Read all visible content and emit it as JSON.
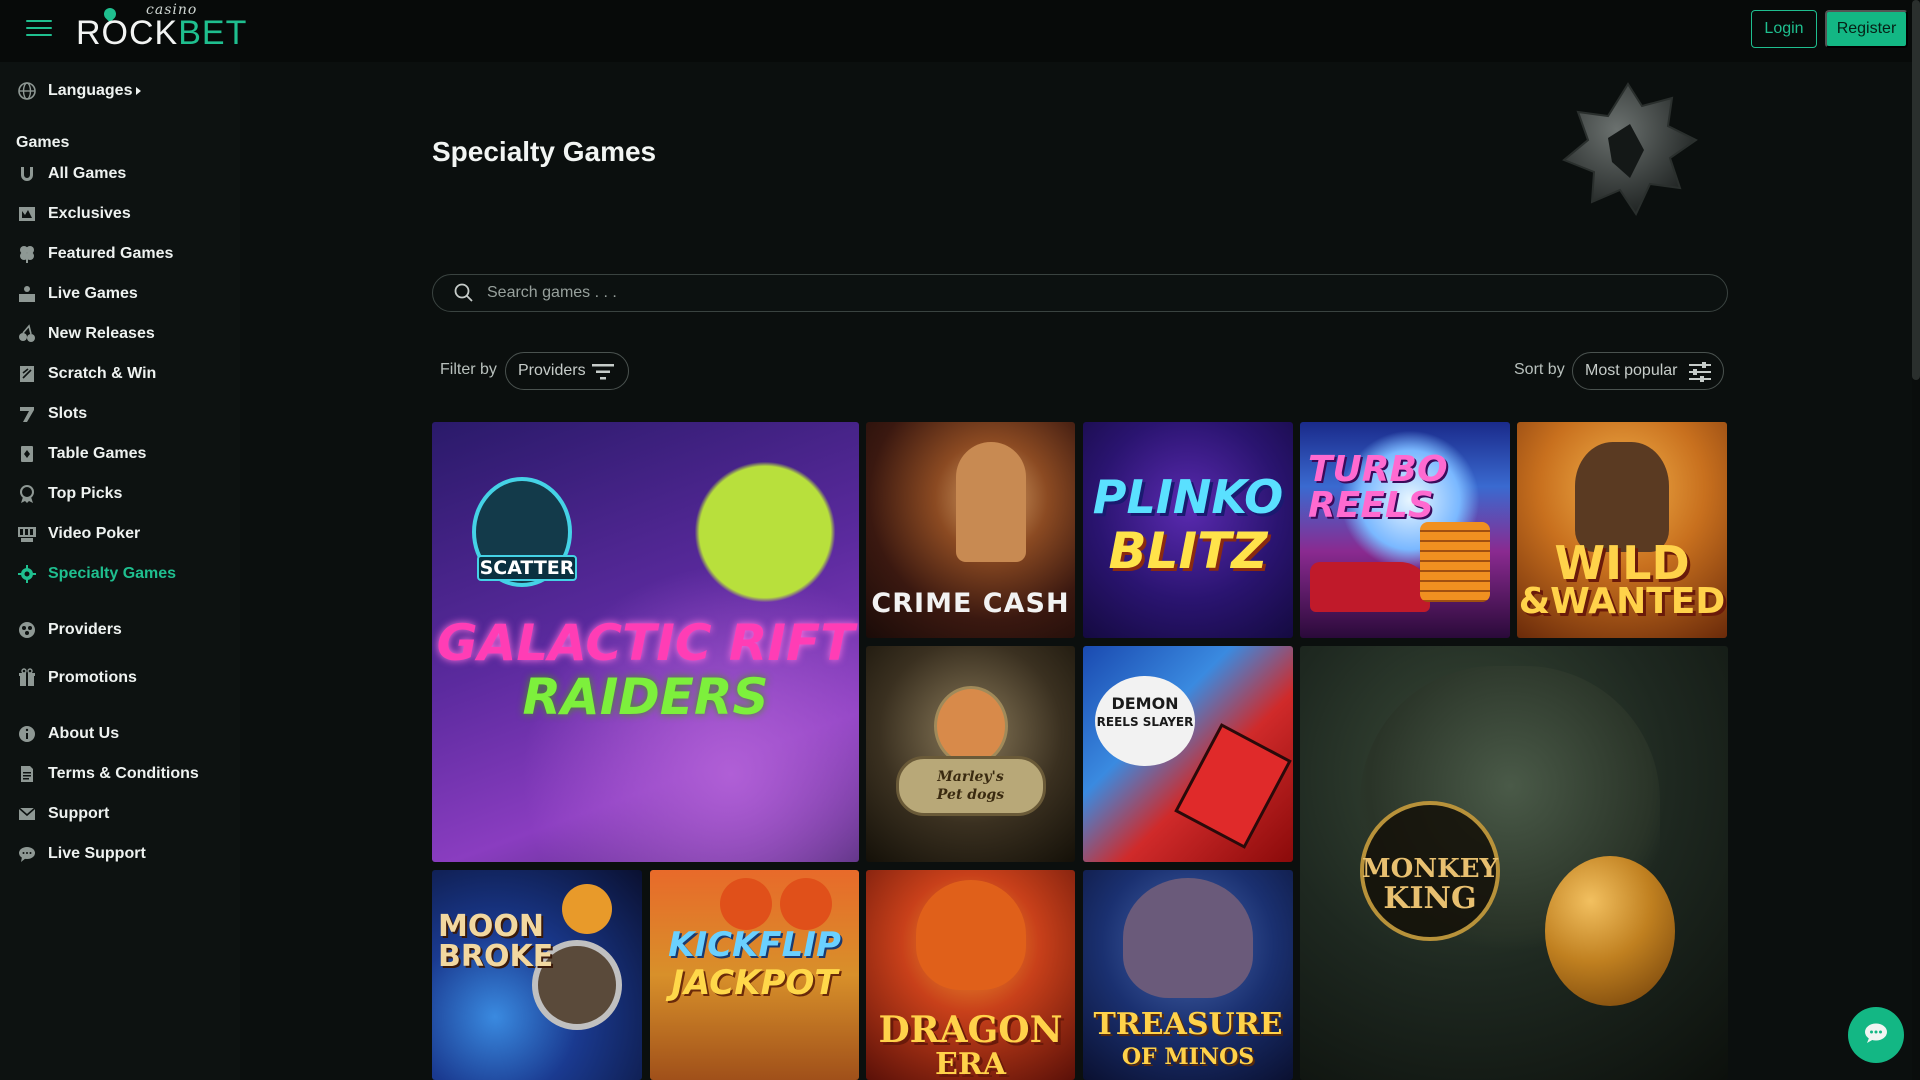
{
  "header": {
    "logo_top": "casino",
    "logo_rock": "ROCK",
    "logo_bet": "BET",
    "login_label": "Login",
    "register_label": "Register"
  },
  "sidebar": {
    "languages": "Languages",
    "games_heading": "Games",
    "items": [
      {
        "label": "All Games",
        "icon": "horseshoe-icon"
      },
      {
        "label": "Exclusives",
        "icon": "exclusive-icon"
      },
      {
        "label": "Featured Games",
        "icon": "clover-icon"
      },
      {
        "label": "Live Games",
        "icon": "dealer-icon"
      },
      {
        "label": "New Releases",
        "icon": "cherries-icon"
      },
      {
        "label": "Scratch & Win",
        "icon": "scratch-icon"
      },
      {
        "label": "Slots",
        "icon": "seven-icon"
      },
      {
        "label": "Table Games",
        "icon": "card-icon"
      },
      {
        "label": "Top Picks",
        "icon": "award-icon"
      },
      {
        "label": "Video Poker",
        "icon": "poker-icon"
      },
      {
        "label": "Specialty Games",
        "icon": "gear-icon"
      }
    ],
    "providers": "Providers",
    "promotions": "Promotions",
    "footer_items": [
      {
        "label": "About Us",
        "icon": "info-icon"
      },
      {
        "label": "Terms & Conditions",
        "icon": "document-icon"
      },
      {
        "label": "Support",
        "icon": "mail-icon"
      },
      {
        "label": "Live Support",
        "icon": "chat-icon"
      }
    ]
  },
  "main": {
    "title": "Specialty Games",
    "search_placeholder": "Search games . . .",
    "filter_label": "Filter by",
    "providers_label": "Providers",
    "sort_label": "Sort by",
    "sort_value": "Most popular"
  },
  "games": [
    {
      "line1": "GALACTIC RIFT",
      "line2": "RAIDERS",
      "badge": "SCATTER"
    },
    {
      "line1": "CRIME",
      "line2": "CASH"
    },
    {
      "line1": "PLINKO",
      "line2": "BLITZ"
    },
    {
      "line1": "TURBO",
      "line2": "REELS"
    },
    {
      "line1": "WILD",
      "line2": "&WANTED"
    },
    {
      "line1": "Marley's",
      "line2": "Pet dogs"
    },
    {
      "line1": "DEMON",
      "line2": "REELS SLAYER"
    },
    {
      "line1": "MONKEY",
      "line2": "KING"
    },
    {
      "line1": "MOON",
      "line2": "BROKE"
    },
    {
      "line1": "KICKFLIP",
      "line2": "JACKPOT"
    },
    {
      "line1": "DRAGON",
      "line2": "ERA"
    },
    {
      "line1": "TREASURE",
      "line2": "OF MINOS"
    }
  ],
  "colors": {
    "accent": "#1fbf8f",
    "background": "#0b0f0e",
    "sidebar": "#0d1211"
  }
}
